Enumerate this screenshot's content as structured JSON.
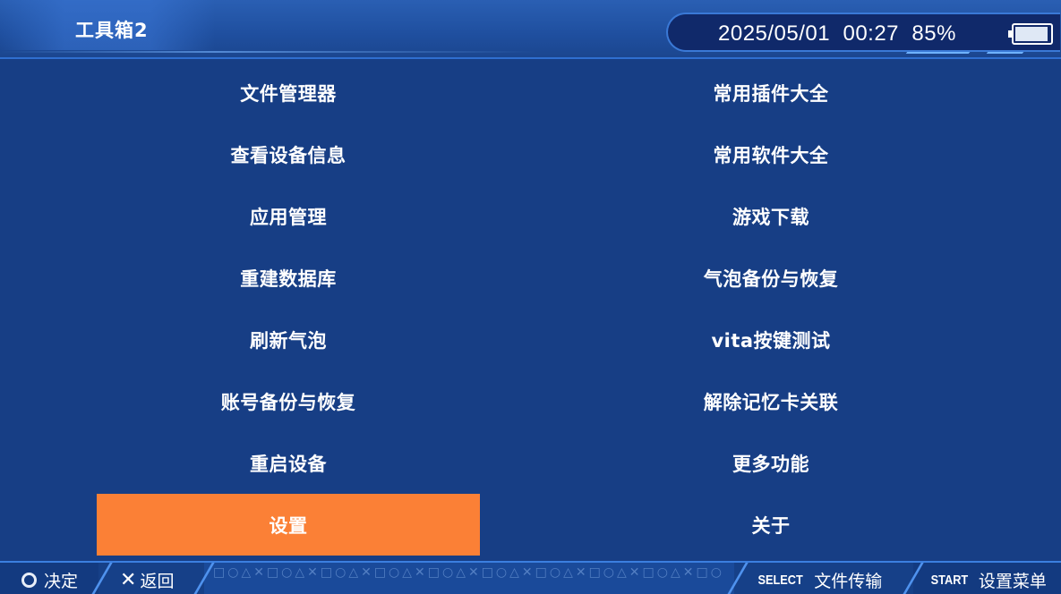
{
  "header": {
    "title": "工具箱2",
    "date": "2025/05/01",
    "time": "00:27",
    "battery_percent": "85%",
    "battery_level": 0.85
  },
  "menu": {
    "left": [
      {
        "label": "文件管理器"
      },
      {
        "label": "查看设备信息"
      },
      {
        "label": "应用管理"
      },
      {
        "label": "重建数据库"
      },
      {
        "label": "刷新气泡"
      },
      {
        "label": "账号备份与恢复"
      },
      {
        "label": "重启设备"
      },
      {
        "label": "设置",
        "selected": true
      }
    ],
    "right": [
      {
        "label": "常用插件大全"
      },
      {
        "label": "常用软件大全"
      },
      {
        "label": "游戏下载"
      },
      {
        "label": "气泡备份与恢复"
      },
      {
        "label": "vita按键测试"
      },
      {
        "label": "解除记忆卡关联"
      },
      {
        "label": "更多功能"
      },
      {
        "label": "关于"
      }
    ],
    "selected_color": "#fb8036"
  },
  "footer": {
    "confirm_label": "决定",
    "confirm_icon": "circle-button-icon",
    "back_label": "返回",
    "back_icon": "cross-button-icon",
    "select_key": "SELECT",
    "select_label": "文件传输",
    "start_key": "START",
    "start_label": "设置菜单",
    "pattern": "□○△✕□○△✕□○△✕□○△✕□○△✕□○△✕□○△✕□○△✕□○△✕□○△✕"
  },
  "colors": {
    "background": "#173e85",
    "header": "#1f4f9f",
    "accent": "#3b7fe0"
  }
}
